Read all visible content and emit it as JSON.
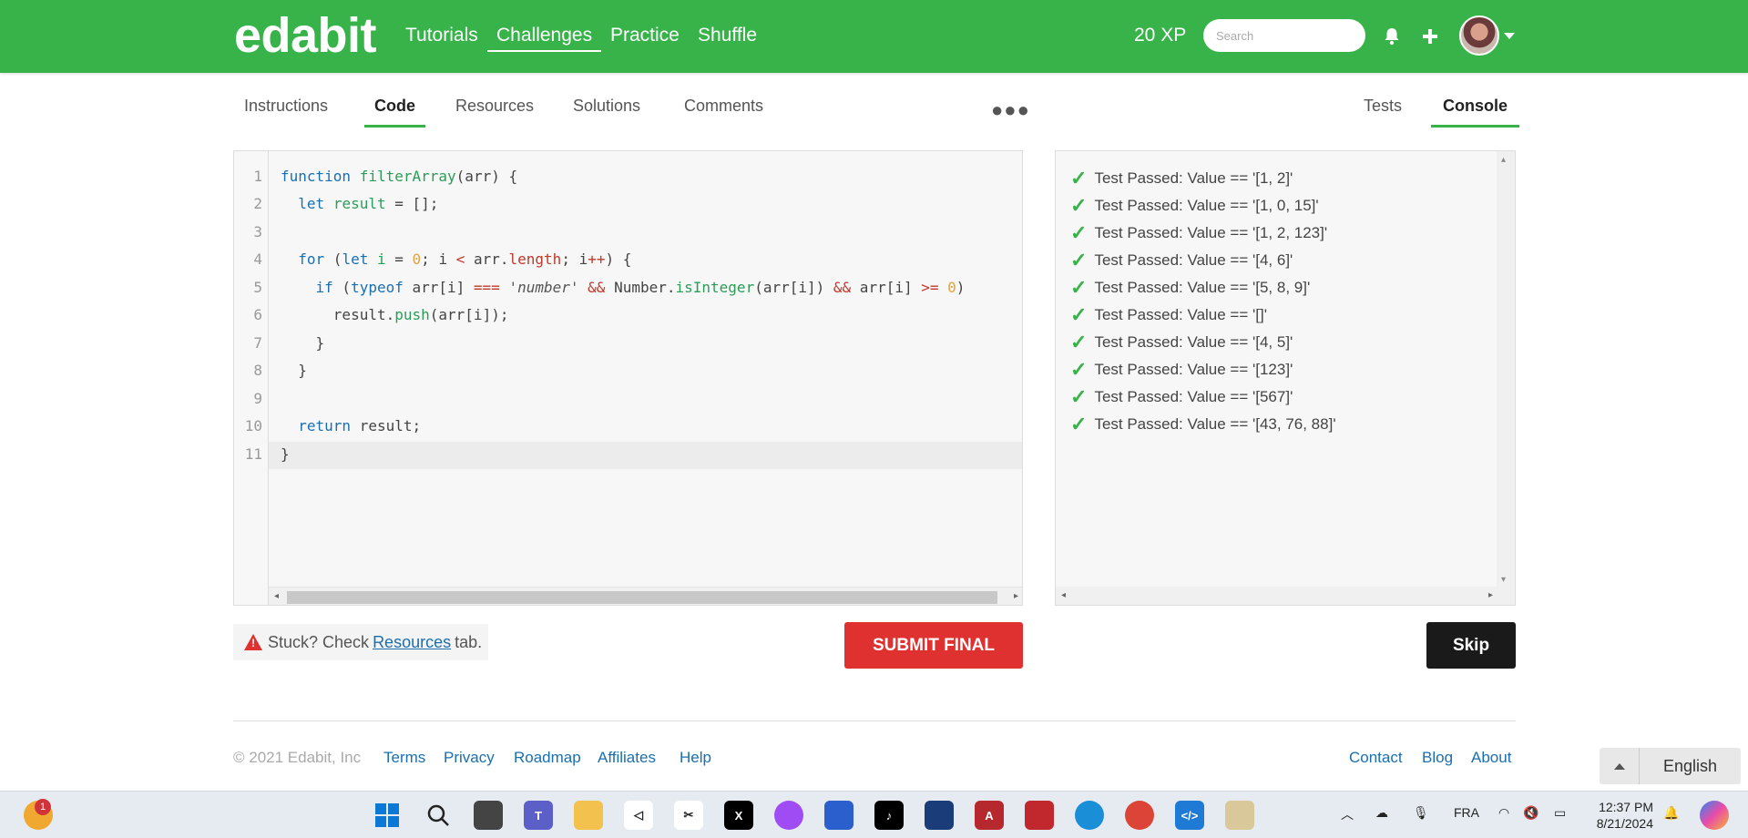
{
  "header": {
    "logo": "edabit",
    "nav": [
      "Tutorials",
      "Challenges",
      "Practice",
      "Shuffle"
    ],
    "active_nav": "Challenges",
    "xp": "20 XP",
    "search_placeholder": "Search"
  },
  "tabs": {
    "left": [
      "Instructions",
      "Code",
      "Resources",
      "Solutions",
      "Comments"
    ],
    "active_left": "Code",
    "right": [
      "Tests",
      "Console"
    ],
    "active_right": "Console"
  },
  "code": {
    "line_numbers": [
      "1",
      "2",
      "3",
      "4",
      "5",
      "6",
      "7",
      "8",
      "9",
      "10",
      "11"
    ],
    "lines": [
      "function filterArray(arr) {",
      "  let result = [];",
      "",
      "  for (let i = 0; i < arr.length; i++) {",
      "    if (typeof arr[i] === 'number' && Number.isInteger(arr[i]) && arr[i] >= 0)",
      "      result.push(arr[i]);",
      "    }",
      "  }",
      "",
      "  return result;",
      "}"
    ]
  },
  "console": {
    "results": [
      "Test Passed: Value == '[1, 2]'",
      "Test Passed: Value == '[1, 0, 15]'",
      "Test Passed: Value == '[1, 2, 123]'",
      "Test Passed: Value == '[4, 6]'",
      "Test Passed: Value == '[5, 8, 9]'",
      "Test Passed: Value == '[]'",
      "Test Passed: Value == '[4, 5]'",
      "Test Passed: Value == '[123]'",
      "Test Passed: Value == '[567]'",
      "Test Passed: Value == '[43, 76, 88]'"
    ]
  },
  "actions": {
    "stuck_prefix": "Stuck? Check",
    "stuck_link": "Resources",
    "stuck_suffix": "tab.",
    "submit": "SUBMIT FINAL",
    "skip": "Skip"
  },
  "footer": {
    "copyright": "© 2021 Edabit, Inc",
    "left_links": [
      "Terms",
      "Privacy",
      "Roadmap",
      "Affiliates",
      "Help"
    ],
    "right_links": [
      "Contact",
      "Blog",
      "About"
    ],
    "language": "English"
  },
  "taskbar": {
    "weather_badge": "1",
    "language": "FRA",
    "time": "12:37 PM",
    "date": "8/21/2024"
  },
  "colors": {
    "brand_green": "#37b34a",
    "submit_red": "#e03131",
    "skip_dark": "#1a1a1a",
    "link_blue": "#1a6fb0"
  }
}
